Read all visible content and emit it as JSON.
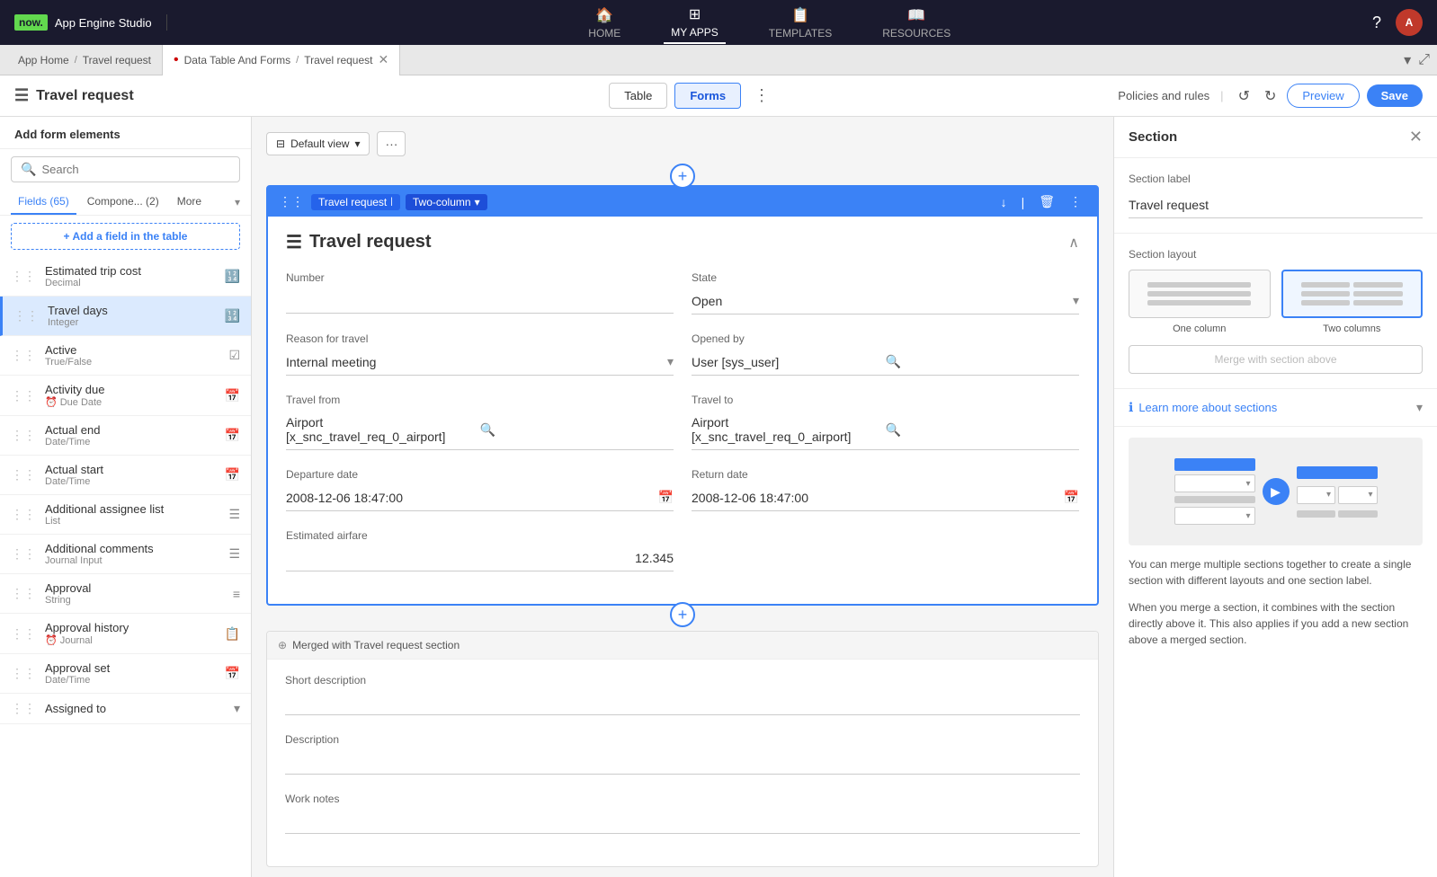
{
  "topNav": {
    "logo": "now.",
    "appName": "App Engine Studio",
    "navItems": [
      {
        "id": "home",
        "label": "HOME",
        "icon": "🏠",
        "active": false
      },
      {
        "id": "myapps",
        "label": "MY APPS",
        "icon": "⊞",
        "active": true
      },
      {
        "id": "templates",
        "label": "TEMPLATES",
        "icon": "📋",
        "active": false
      },
      {
        "id": "resources",
        "label": "RESOURCES",
        "icon": "📖",
        "active": false
      }
    ]
  },
  "tabBar": {
    "homeTab": "App Home",
    "homeSubtab": "Travel request",
    "activeTab": "Data Table And Forms",
    "activeSubtab": "Travel request"
  },
  "toolbar": {
    "pageTitle": "Travel request",
    "tableLabel": "Table",
    "formsLabel": "Forms",
    "policiesLabel": "Policies and rules",
    "previewLabel": "Preview",
    "saveLabel": "Save"
  },
  "leftPanel": {
    "header": "Add form elements",
    "searchPlaceholder": "Search",
    "tabs": [
      {
        "id": "fields",
        "label": "Fields (65)",
        "active": true
      },
      {
        "id": "components",
        "label": "Compone... (2)",
        "active": false
      },
      {
        "id": "more",
        "label": "More",
        "active": false
      }
    ],
    "addFieldLabel": "+ Add a field in the table",
    "fields": [
      {
        "name": "Estimated trip cost",
        "type": "Decimal",
        "icon": "🔢",
        "selected": false
      },
      {
        "name": "Travel days",
        "type": "Integer",
        "icon": "🔢",
        "selected": true
      },
      {
        "name": "Active",
        "type": "True/False",
        "icon": "☑",
        "selected": false
      },
      {
        "name": "Activity due",
        "type": "Due Date",
        "icon": "📅",
        "selected": false,
        "typeIcon": "⏰"
      },
      {
        "name": "Actual end",
        "type": "Date/Time",
        "icon": "📅",
        "selected": false
      },
      {
        "name": "Actual start",
        "type": "Date/Time",
        "icon": "📅",
        "selected": false
      },
      {
        "name": "Additional assignee list",
        "type": "List",
        "icon": "☰",
        "selected": false
      },
      {
        "name": "Additional comments",
        "type": "Journal Input",
        "icon": "☰",
        "selected": false
      },
      {
        "name": "Approval",
        "type": "String",
        "icon": "≡",
        "selected": false
      },
      {
        "name": "Approval history",
        "type": "Journal",
        "icon": "📋",
        "selected": false,
        "typeIcon": "⏰"
      },
      {
        "name": "Approval set",
        "type": "Date/Time",
        "icon": "📅",
        "selected": false
      },
      {
        "name": "Assigned to",
        "type": "",
        "icon": "",
        "selected": false
      }
    ]
  },
  "viewToolbar": {
    "defaultViewLabel": "Default view",
    "moreLabel": "···"
  },
  "formSection": {
    "sectionName": "Travel request",
    "twoColumnLabel": "Two-column",
    "title": "Travel request",
    "fields": {
      "number": {
        "label": "Number",
        "value": ""
      },
      "state": {
        "label": "State",
        "value": "Open"
      },
      "reasonForTravel": {
        "label": "Reason for travel",
        "value": "Internal meeting"
      },
      "openedBy": {
        "label": "Opened by",
        "value": "User [sys_user]"
      },
      "travelFrom": {
        "label": "Travel from",
        "value": "Airport [x_snc_travel_req_0_airport]"
      },
      "travelTo": {
        "label": "Travel to",
        "value": "Airport [x_snc_travel_req_0_airport]"
      },
      "departureDate": {
        "label": "Departure date",
        "value": "2008-12-06 18:47:00"
      },
      "returnDate": {
        "label": "Return date",
        "value": "2008-12-06 18:47:00"
      },
      "estimatedAirfare": {
        "label": "Estimated airfare",
        "value": "12.345"
      }
    }
  },
  "mergedSection": {
    "badgeLabel": "Merged with Travel request section",
    "fields": {
      "shortDescription": {
        "label": "Short description",
        "value": ""
      },
      "description": {
        "label": "Description",
        "value": ""
      },
      "workNotes": {
        "label": "Work notes",
        "value": ""
      }
    }
  },
  "rightPanel": {
    "title": "Section",
    "sectionLabelTitle": "Section label",
    "sectionLabelValue": "Travel request",
    "sectionLayoutTitle": "Section layout",
    "oneColumnLabel": "One column",
    "twoColumnsLabel": "Two columns",
    "mergeAboveLabel": "Merge with section above",
    "learnMoreLabel": "Learn more about sections",
    "infoText1": "You can merge multiple sections together to create a single section with different layouts and one section label.",
    "infoText2": "When you merge a section, it combines with the section directly above it. This also applies if you add a new section above a merged section."
  }
}
